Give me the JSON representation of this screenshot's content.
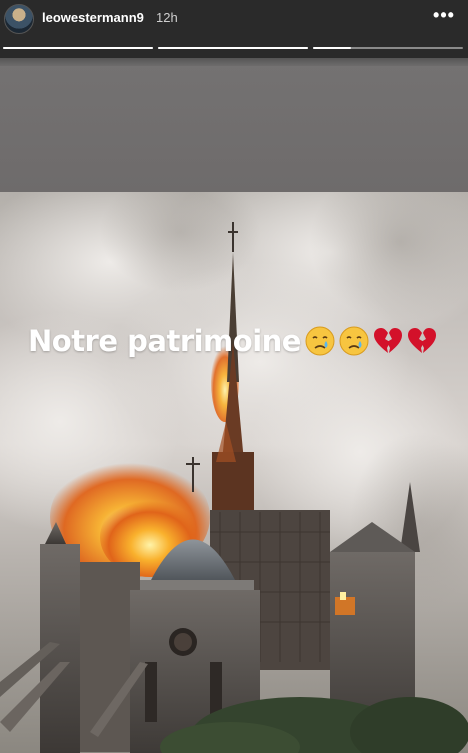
{
  "header": {
    "username": "leowestermann9",
    "time_ago": "12h",
    "more_label": "•••",
    "story_progress": [
      1.0,
      1.0,
      0.25
    ]
  },
  "story": {
    "caption": "Notre patrimoine",
    "emoji": [
      "crying-face-icon",
      "crying-face-icon",
      "broken-heart-icon",
      "broken-heart-icon"
    ]
  },
  "colors": {
    "header_bg": "#2a2a2a",
    "gray_band": "#747272",
    "fire": "#f08a1e",
    "smoke": "#d8d3cf",
    "broken_heart": "#d3112a",
    "crying_face": "#f7c540"
  }
}
